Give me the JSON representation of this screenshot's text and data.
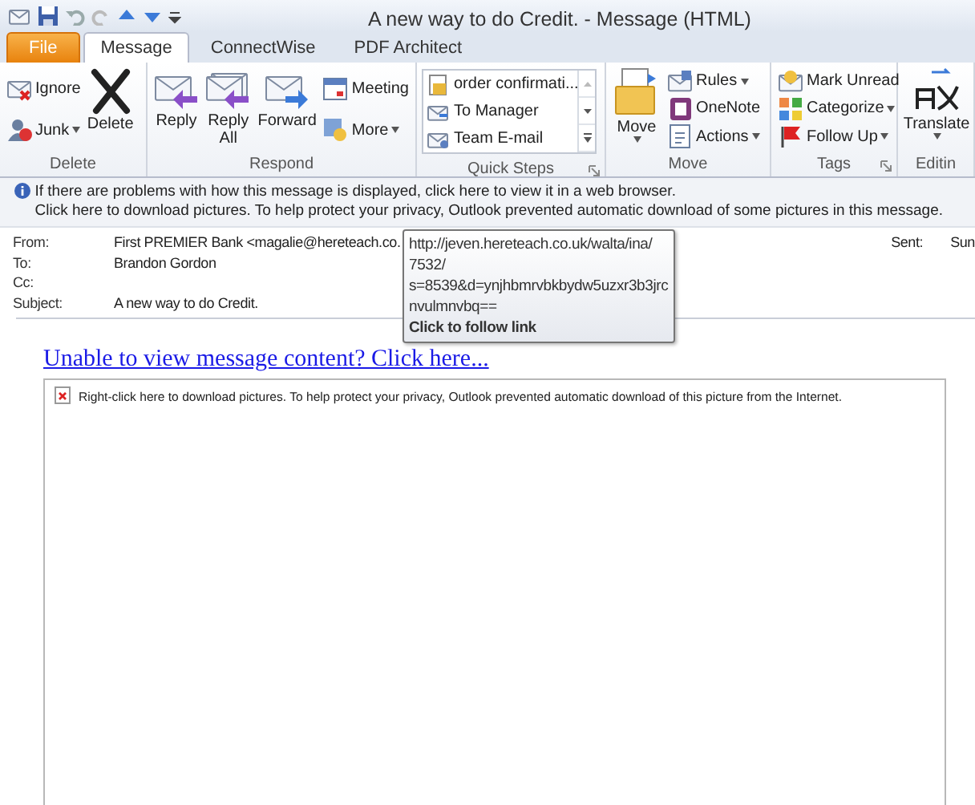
{
  "window": {
    "title": "A new way to do Credit.  -  Message (HTML)"
  },
  "tabs": [
    {
      "label": "File",
      "kind": "backstage",
      "selected": false
    },
    {
      "label": "Message",
      "kind": "tab",
      "selected": true
    },
    {
      "label": "ConnectWise",
      "kind": "tab",
      "selected": false
    },
    {
      "label": "PDF Architect",
      "kind": "tab",
      "selected": false
    }
  ],
  "ribbon": {
    "groups": [
      {
        "label": "Delete",
        "launcher": false,
        "items": [
          {
            "kind": "stack",
            "items": [
              {
                "label": "Ignore",
                "dropdown": false
              },
              {
                "label": "Junk",
                "dropdown": true
              }
            ]
          },
          {
            "kind": "large",
            "label": "Delete",
            "dropdown": false
          }
        ]
      },
      {
        "label": "Respond",
        "launcher": false,
        "items": [
          {
            "kind": "large",
            "label": "Reply",
            "dropdown": false
          },
          {
            "kind": "large",
            "label": "Reply All",
            "dropdown": false
          },
          {
            "kind": "large",
            "label": "Forward",
            "dropdown": false
          },
          {
            "kind": "stack",
            "items": [
              {
                "label": "Meeting",
                "dropdown": false
              },
              {
                "label": "More",
                "dropdown": true
              }
            ]
          }
        ]
      },
      {
        "label": "Quick Steps",
        "launcher": true,
        "items": [
          {
            "kind": "gallery",
            "items": [
              "order confirmati...",
              "To Manager",
              "Team E-mail"
            ]
          }
        ]
      },
      {
        "label": "Move",
        "launcher": false,
        "items": [
          {
            "kind": "large",
            "label": "Move",
            "dropdown": true
          },
          {
            "kind": "stack",
            "items": [
              {
                "label": "Rules",
                "dropdown": true
              },
              {
                "label": "OneNote",
                "dropdown": false
              },
              {
                "label": "Actions",
                "dropdown": true
              }
            ]
          }
        ]
      },
      {
        "label": "Tags",
        "launcher": true,
        "items": [
          {
            "kind": "stack",
            "items": [
              {
                "label": "Mark Unread",
                "dropdown": false
              },
              {
                "label": "Categorize",
                "dropdown": true
              },
              {
                "label": "Follow Up",
                "dropdown": true
              }
            ]
          }
        ]
      },
      {
        "label": "Editin",
        "launcher": false,
        "items": [
          {
            "kind": "large",
            "label": "Translate",
            "dropdown": true
          }
        ]
      }
    ]
  },
  "infobar": [
    "If there are problems with how this message is displayed, click here to view it in a web browser.",
    "Click here to download pictures. To help protect your privacy, Outlook prevented automatic download of some pictures in this message."
  ],
  "header": [
    {
      "label": "From:",
      "value": "First PREMIER Bank  <magalie@hereteach.co."
    },
    {
      "label": "To:",
      "value": "Brandon Gordon"
    },
    {
      "label": "Cc:"
    },
    {
      "label": "Subject:",
      "value": "A new way to do Credit."
    }
  ],
  "sent": {
    "label": "Sent:",
    "value": "Sun"
  },
  "tooltip": {
    "url_lines": [
      "http://jeven.hereteach.co.uk/walta/ina/",
      "7532/",
      "s=8539&d=ynjhbmrvbkbydw5uzxr3b3jrc",
      "nvulmnvbq=="
    ],
    "hint": "Click to follow link"
  },
  "body": {
    "link": "Unable to view message content? Click here...",
    "blocked_image": "Right-click here to download pictures.  To help protect your privacy, Outlook prevented automatic download of this picture from the Internet."
  }
}
